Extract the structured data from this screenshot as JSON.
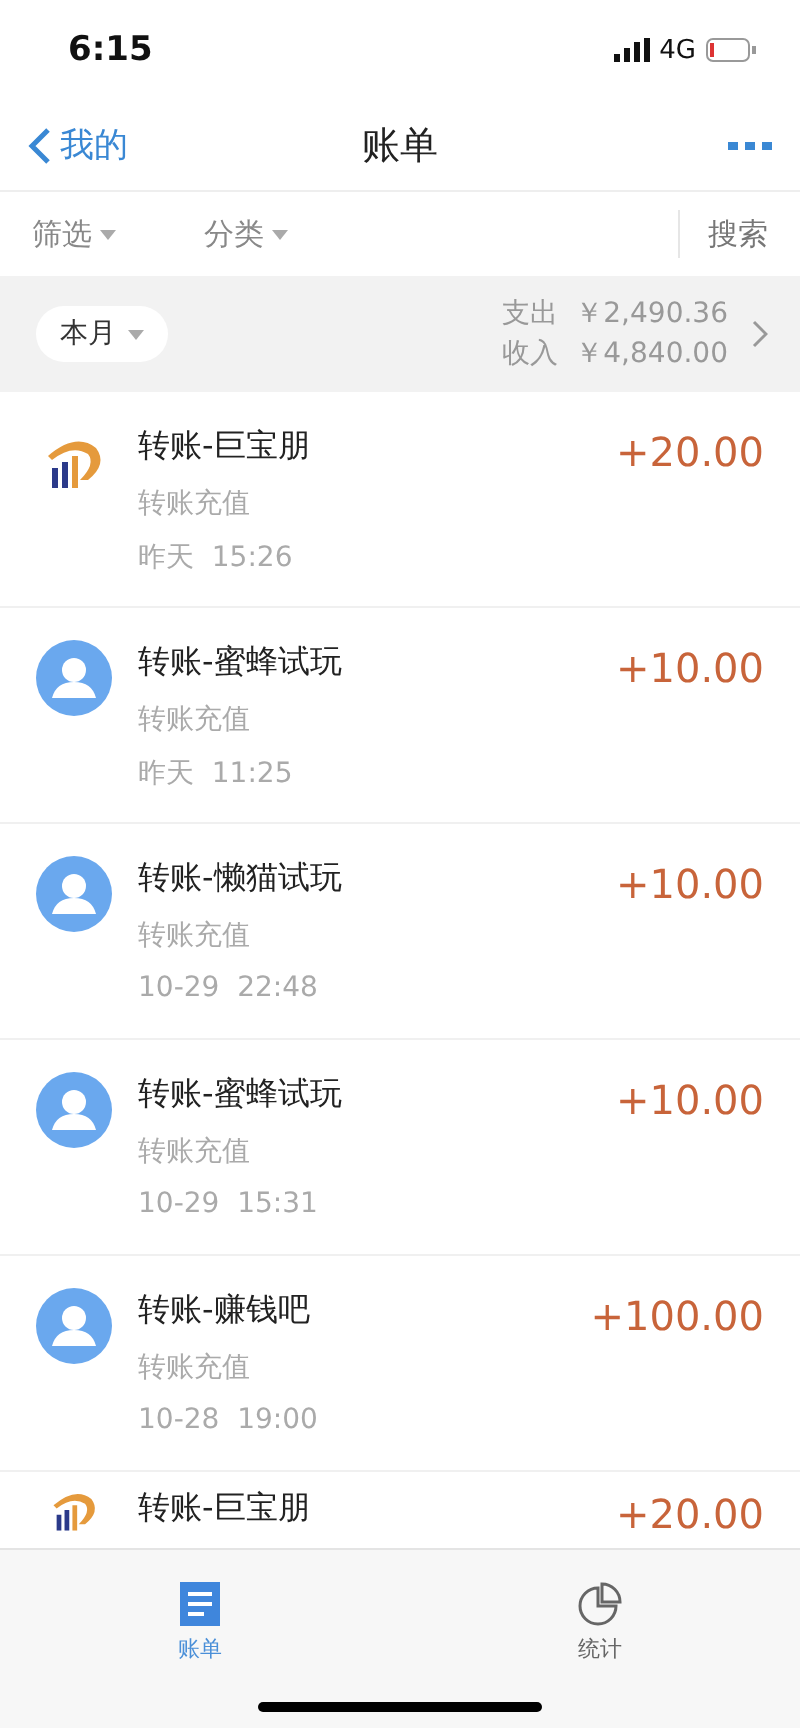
{
  "status_bar": {
    "time": "6:15",
    "network": "4G"
  },
  "nav": {
    "back": "我的",
    "title": "账单"
  },
  "filters": [
    {
      "label": "筛选"
    },
    {
      "label": "分类"
    }
  ],
  "search": "搜索",
  "period": {
    "label": "本月",
    "expense_label": "支出",
    "expense": "￥2,490.36",
    "income_label": "收入",
    "income": "￥4,840.00"
  },
  "transactions": [
    {
      "kind": "logo",
      "title": "转账-巨宝朋",
      "amount": "+20.00",
      "category": "转账充值",
      "time": "昨天  15:26"
    },
    {
      "kind": "person",
      "title": "转账-蜜蜂试玩",
      "amount": "+10.00",
      "category": "转账充值",
      "time": "昨天  11:25"
    },
    {
      "kind": "person",
      "title": "转账-懒猫试玩",
      "amount": "+10.00",
      "category": "转账充值",
      "time": "10-29  22:48"
    },
    {
      "kind": "person",
      "title": "转账-蜜蜂试玩",
      "amount": "+10.00",
      "category": "转账充值",
      "time": "10-29  15:31"
    },
    {
      "kind": "person",
      "title": "转账-赚钱吧",
      "amount": "+100.00",
      "category": "转账充值",
      "time": "10-28  19:00"
    },
    {
      "kind": "logo",
      "title": "转账-巨宝朋",
      "amount": "+20.00"
    }
  ],
  "tabs": [
    {
      "label": "账单",
      "selected": true
    },
    {
      "label": "统计",
      "selected": false
    }
  ]
}
